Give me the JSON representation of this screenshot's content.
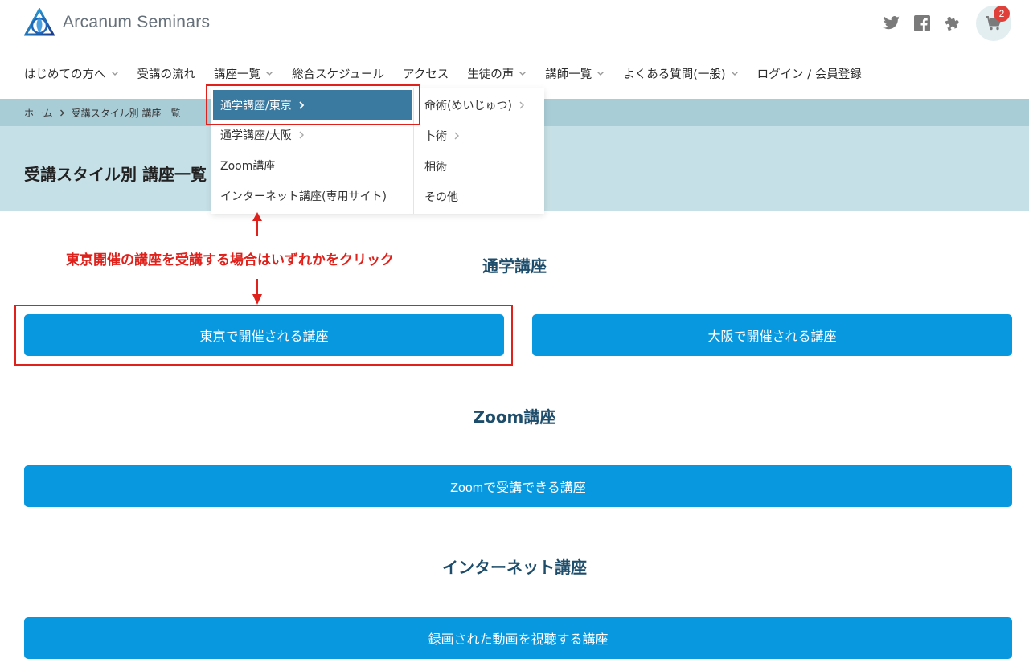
{
  "header": {
    "logo_text": "Arcanum Seminars",
    "icons": [
      "twitter-icon",
      "facebook-icon",
      "puzzle-icon",
      "cart-icon"
    ],
    "cart_count": "2"
  },
  "nav": {
    "items": [
      {
        "label": "はじめての方へ",
        "has_dropdown": true
      },
      {
        "label": "受講の流れ",
        "has_dropdown": false
      },
      {
        "label": "講座一覧",
        "has_dropdown": true
      },
      {
        "label": "総合スケジュール",
        "has_dropdown": false
      },
      {
        "label": "アクセス",
        "has_dropdown": false
      },
      {
        "label": "生徒の声",
        "has_dropdown": true
      },
      {
        "label": "講師一覧",
        "has_dropdown": true
      },
      {
        "label": "よくある質問(一般)",
        "has_dropdown": true
      },
      {
        "label": "ログイン / 会員登録",
        "has_dropdown": false
      }
    ]
  },
  "dropdown": {
    "col1": [
      "通学講座/東京",
      "通学講座/大阪",
      "Zoom講座",
      "インターネット講座(専用サイト)"
    ],
    "col2": [
      "命術(めいじゅつ)",
      "卜術",
      "相術",
      "その他"
    ]
  },
  "breadcrumb": {
    "home": "ホーム",
    "current": "受講スタイル別 講座一覧"
  },
  "page_title": "受講スタイル別 講座一覧",
  "annotation": "東京開催の講座を受講する場合はいずれかをクリック",
  "sections": {
    "tsugaku": {
      "title": "通学講座",
      "tokyo_button": "東京で開催される講座",
      "osaka_button": "大阪で開催される講座"
    },
    "zoom": {
      "title": "Zoom講座",
      "button": "Zoomで受講できる講座"
    },
    "internet": {
      "title": "インターネット講座",
      "button": "録画された動画を視聴する講座"
    }
  },
  "colors": {
    "button": "#0898e0",
    "dropdown_active": "#3a7aa0",
    "annotation_red": "#e0201a",
    "section_title": "#1e4d6b",
    "breadcrumb_band": "#a9cdd7",
    "title_band": "#c6e0e7"
  }
}
